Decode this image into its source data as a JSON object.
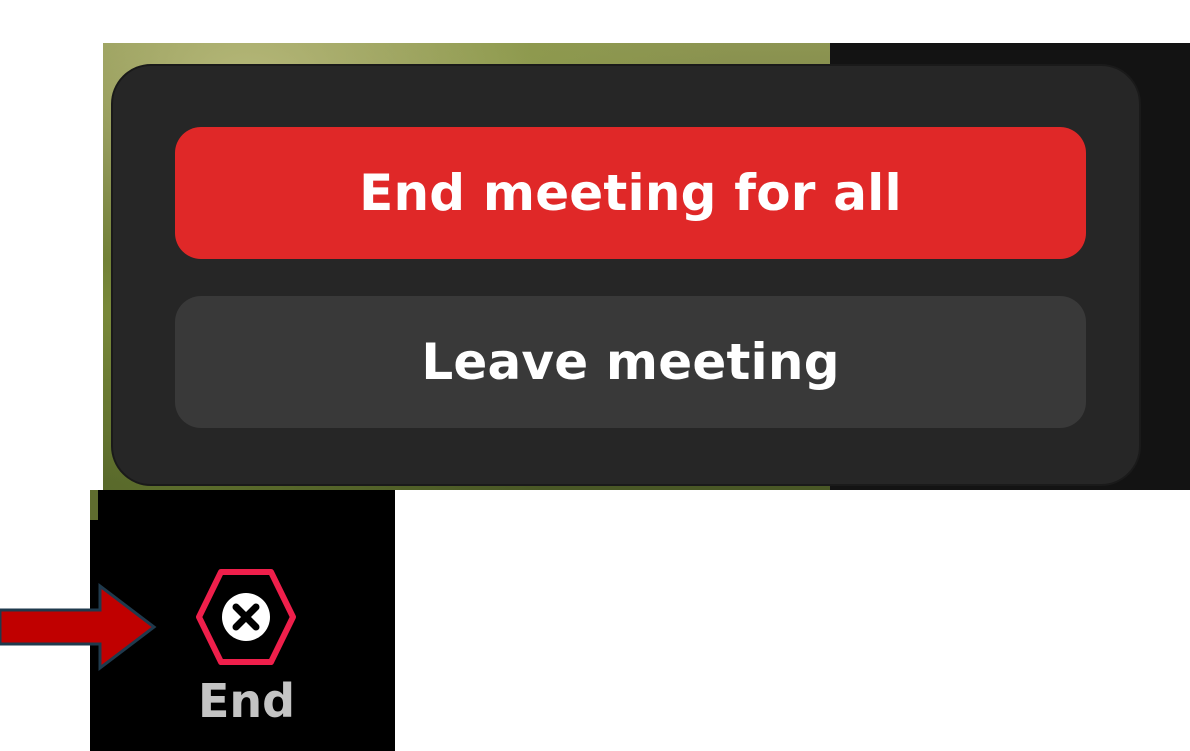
{
  "popup": {
    "end_all_label": "End meeting for all",
    "leave_label": "Leave meeting"
  },
  "toolbar": {
    "end_label": "End",
    "end_icon": "close-hexagon-icon"
  },
  "annotation": {
    "arrow_icon": "arrow-right-icon"
  },
  "colors": {
    "end_all_bg": "#e02828",
    "leave_bg": "#393939",
    "popup_bg": "#262626",
    "end_icon_outline": "#ef1f4b",
    "arrow_fill": "#c00000"
  }
}
